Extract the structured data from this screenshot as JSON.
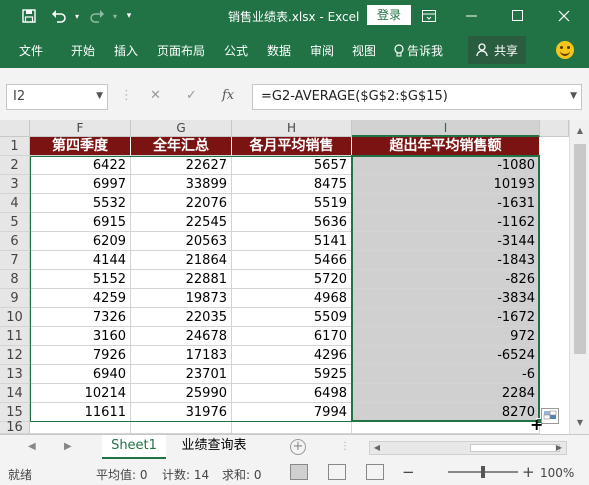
{
  "window": {
    "title": "销售业绩表.xlsx - Excel",
    "login_label": "登录"
  },
  "ribbon": {
    "tabs": [
      "文件",
      "开始",
      "插入",
      "页面布局",
      "公式",
      "数据",
      "审阅",
      "视图"
    ],
    "tell_me": "告诉我",
    "share": "共享"
  },
  "formula_bar": {
    "name_box": "I2",
    "fx": "fx",
    "formula": "=G2-AVERAGE($G$2:$G$15)"
  },
  "grid": {
    "columns": [
      "F",
      "G",
      "H",
      "I"
    ],
    "rows": [
      "1",
      "2",
      "3",
      "4",
      "5",
      "6",
      "7",
      "8",
      "9",
      "10",
      "11",
      "12",
      "13",
      "14",
      "15",
      "16"
    ],
    "headers": [
      "第四季度",
      "全年汇总",
      "各月平均销售",
      "超出年平均销售额"
    ],
    "data": [
      [
        "6422",
        "22627",
        "5657",
        "-1080"
      ],
      [
        "6997",
        "33899",
        "8475",
        "10193"
      ],
      [
        "5532",
        "22076",
        "5519",
        "-1631"
      ],
      [
        "6915",
        "22545",
        "5636",
        "-1162"
      ],
      [
        "6209",
        "20563",
        "5141",
        "-3144"
      ],
      [
        "4144",
        "21864",
        "5466",
        "-1843"
      ],
      [
        "5152",
        "22881",
        "5720",
        "-826"
      ],
      [
        "4259",
        "19873",
        "4968",
        "-3834"
      ],
      [
        "7326",
        "22035",
        "5509",
        "-1672"
      ],
      [
        "3160",
        "24678",
        "6170",
        "972"
      ],
      [
        "7926",
        "17183",
        "4296",
        "-6524"
      ],
      [
        "6940",
        "23701",
        "5925",
        "-6"
      ],
      [
        "10214",
        "25990",
        "6498",
        "2284"
      ],
      [
        "11611",
        "31976",
        "7994",
        "8270"
      ]
    ]
  },
  "sheets": {
    "tabs": [
      "Sheet1",
      "业绩查询表"
    ],
    "active": 0
  },
  "status": {
    "mode": "就绪",
    "average": "平均值: 0",
    "count": "计数: 14",
    "sum": "求和: 0",
    "zoom": "100%"
  },
  "colors": {
    "accent": "#217346",
    "header_fill": "#7b1313",
    "selection_fill": "#d0d0d0"
  }
}
